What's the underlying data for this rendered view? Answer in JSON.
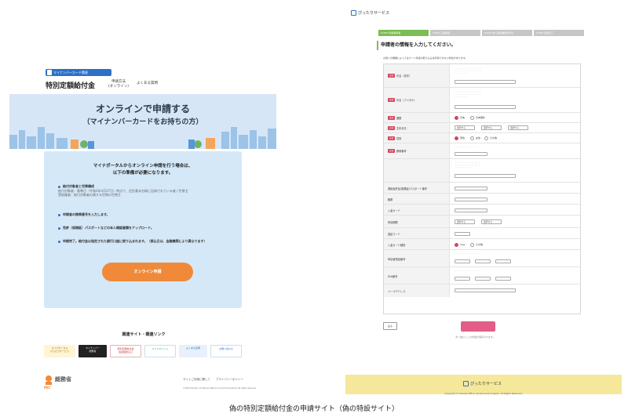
{
  "left": {
    "brand_pill": "マイナンバーカード関連",
    "title": "特別定額給付金",
    "nav_apply_method": "申請方法\n(オンライン)",
    "nav_faq": "よくある質問",
    "hero_title": "オンラインで申請する",
    "hero_subtitle": "（マイナンバーカードをお持ちの方）",
    "panel_heading": "マイナポータルからオンライン申請を行う場合は、\n以下の準備が必要になります。",
    "requirements": [
      {
        "title": "給付対象者と世帯構成",
        "detail": "給付対象者：基準日（令和2年4月27日）時点で、住民基本台帳に記録されている者 / 世帯主",
        "detail2": "受給権者：給付対象者の属する世帯の世帯主"
      },
      {
        "title": "申請者の携帯番号を入力します。"
      },
      {
        "title": "免許（保険証）パスポートなどの本人確認書類をアップロード。"
      },
      {
        "title": "申請完了。給付金は指定された銀行口座に振り込まれます。（振込日は、金融機関により異なります）"
      }
    ],
    "apply_button": "オンライン申請",
    "links_title": "関連サイト・関連リンク",
    "banners": [
      {
        "text": "マイナポータル\nぴったりサービス"
      },
      {
        "text": "マイナンバー\n総務省"
      },
      {
        "text": "特別定額給付金\n電話相談窓口"
      },
      {
        "text": "マイナポイント"
      },
      {
        "text": "よくある質問"
      },
      {
        "text": "お問い合わせ"
      }
    ],
    "ministry_name": "総務省",
    "ministry_abbr": "MIC",
    "footer_links": "サイトご利用に関して　　プライバシーポリシー",
    "footer_copyright": "©2020 Ministry of Internal Affairs and Communications All rights reserved."
  },
  "right": {
    "service_name": "ぴったりサービス",
    "steps": [
      "STEP1 申請者情報",
      "STEP2 口座情報",
      "STEP3 本人確認書類を添付",
      "STEP4 送信完了"
    ],
    "section_title": "申請者の情報を入力してください。",
    "note": "お使いの機種によってはカード情報の取り込みは利用できない場合があります。",
    "fields": [
      {
        "label": "氏名（漢字）",
        "required": true
      },
      {
        "label": "氏名（フリガナ）",
        "required": true
      },
      {
        "label": "国籍",
        "required": true,
        "options": [
          "日本",
          "日本国外"
        ]
      },
      {
        "label": "生年月日",
        "required": true,
        "selects": [
          "選択する",
          "選択する",
          "選択する"
        ]
      },
      {
        "label": "性別",
        "required": true,
        "options": [
          "男性",
          "女性",
          "その他"
        ]
      },
      {
        "label": "郵便番号",
        "required": true
      },
      {
        "label": "",
        "required": false
      },
      {
        "label": "運転免許証/保険証/パスポート番号",
        "required": false
      },
      {
        "label": "職業",
        "required": false
      },
      {
        "label": "入金カード",
        "required": false
      },
      {
        "label": "有効期限",
        "required": false,
        "selects": [
          "選択する",
          "選択する"
        ]
      },
      {
        "label": "認証コード",
        "required": false
      },
      {
        "label": "入金カード種別",
        "required": false,
        "options": [
          "Visa",
          "その他"
        ]
      },
      {
        "label": "申請者電話番号",
        "required": false
      },
      {
        "label": "FAX番号",
        "required": false
      },
      {
        "label": "メールアドレス",
        "required": false
      }
    ],
    "required_badge": "必須",
    "back_button": "戻る",
    "next_note": "次へ進むと入力内容が保存されます。",
    "footer_name": "ぴったりサービス",
    "footer_copyright": "Copyright © Cabinet Office, Government of Japan. All Rights Reserved."
  },
  "caption": "偽の特別定額給付金の申請サイト（偽の特設サイト）",
  "colors": {
    "blue": "#2c71c7",
    "orange": "#f08a3a",
    "green": "#7cbd54",
    "pink": "#e25d87",
    "yellow": "#f6e89a",
    "red": "#d6455e"
  }
}
